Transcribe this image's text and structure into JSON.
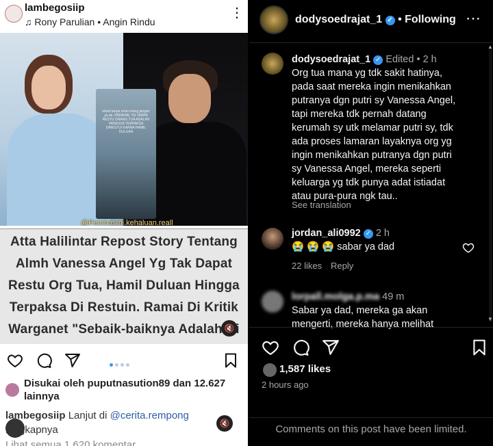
{
  "left_post": {
    "username": "lambegosiip",
    "music": "Rony Parulian • Angin Rindu",
    "image_watermark": "@Pembasmi.kehaluan.reall",
    "story_text": "nikah tanpa restu orang jangan ya de. PADAHAL YG TANPA RESTU ORANG TUA ADALAH VANESSA TERPAKSA DIRESTUI KARNA HAMIL DULUAN",
    "headline_lines": [
      "Atta Halilintar Repost Story Tentang",
      "Almh Vanessa Angel Yg Tak Dapat",
      "Restu Org Tua, Hamil Duluan Hingga",
      "Terpaksa Di Restuin. Ramai Di Kritik",
      "Warganet \"Sebaik-baiknya Adalah Di"
    ],
    "likes_text": "Disukai oleh puputnasution89 dan 12.627 lainnya",
    "caption_user": "lambegosiip",
    "caption_text": "Lanjut di",
    "caption_link": "@cerita.rempong",
    "caption_more": "lengkapnya",
    "view_all": "Lihat semua 1.620 komentar"
  },
  "right_post": {
    "header": {
      "username": "dodysoedrajat_1",
      "separator": "•",
      "following": "Following"
    },
    "main_comment": {
      "username": "dodysoedrajat_1",
      "edited": "Edited",
      "time": "2 h",
      "text_lines": [
        "Org tua mana yg tdk sakit hatinya,",
        "pada saat mereka ingin menikahkan",
        "putranya dgn putri sy Vanessa Angel,",
        "tapi mereka tdk pernah datang",
        "kerumah sy utk melamar putri sy, tdk",
        "ada proses lamaran layaknya org yg",
        "ingin menikahkan putranya dgn putri",
        "sy Vanessa Angel, mereka seperti",
        "keluarga yg tdk punya adat istiadat",
        "atau pura-pura ngk tau.."
      ],
      "see_translation": "See translation"
    },
    "reply_1": {
      "username": "jordan_ali0992",
      "time": "2 h",
      "emojis": "😭 😭 😭",
      "text": "sabar ya dad",
      "likes": "22 likes",
      "reply": "Reply"
    },
    "reply_2": {
      "username": "lorpall.molga.p.ma",
      "time": "49 m",
      "text_lines": [
        "Sabar ya dad, mereka ga akan",
        "mengerti, mereka hanya melihat"
      ]
    },
    "likes": "1,587 likes",
    "time_ago": "2 hours ago",
    "limited": "Comments on this post have been limited."
  }
}
